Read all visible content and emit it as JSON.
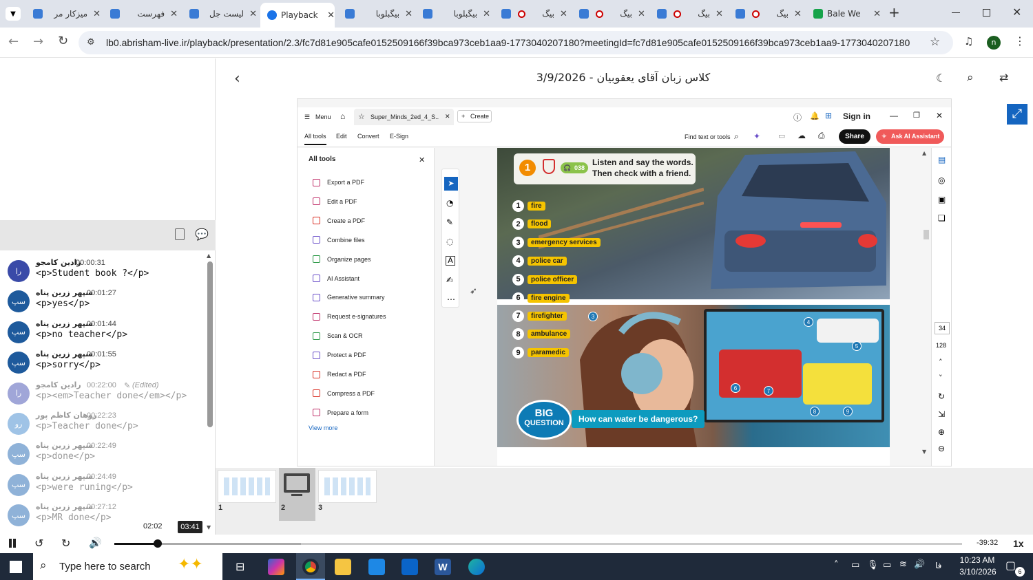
{
  "browser": {
    "tabs": [
      {
        "label": "میزکار مر",
        "type": "plain"
      },
      {
        "label": "فهرست",
        "type": "plain"
      },
      {
        "label": "لیست جل",
        "type": "plain"
      },
      {
        "label": "Playback",
        "type": "active"
      },
      {
        "label": "بیگبلوبا",
        "type": "plain"
      },
      {
        "label": "بیگبلوبا",
        "type": "plain"
      },
      {
        "label": "بیگ",
        "type": "rec"
      },
      {
        "label": "بیگ",
        "type": "rec"
      },
      {
        "label": "بیگ",
        "type": "rec"
      },
      {
        "label": "بیگ",
        "type": "rec"
      },
      {
        "label": "Bale We",
        "type": "bale"
      }
    ],
    "new_tab": "+",
    "url": "lb0.abrisham-live.ir/playback/presentation/2.3/fc7d81e905cafe0152509166f39bca973ceb1aa9-1773040207180?meetingId=fc7d81e905cafe0152509166f39bca973ceb1aa9-1773040207180",
    "profile_initial": "n"
  },
  "header": {
    "title": "کلاس زبان آقای یعقوبیان - 3/9/2026"
  },
  "chat": {
    "messages": [
      {
        "initials": "را",
        "name": "رادین کامجو",
        "time": "00:00:31",
        "text": "<p>Student book ?</p>",
        "edited": "",
        "faded": false,
        "color": "#3a4aa8"
      },
      {
        "initials": "سپ",
        "name": "سپهر زرین پناه",
        "time": "00:01:27",
        "text": "<p>yes</p>",
        "edited": "",
        "faded": false,
        "color": "#1e5a9c"
      },
      {
        "initials": "سپ",
        "name": "سپهر زرین پناه",
        "time": "00:01:44",
        "text": "<p>no teacher</p>",
        "edited": "",
        "faded": false,
        "color": "#1e5a9c"
      },
      {
        "initials": "سپ",
        "name": "سپهر زرین پناه",
        "time": "00:01:55",
        "text": "<p>sorry</p>",
        "edited": "",
        "faded": false,
        "color": "#1e5a9c"
      },
      {
        "initials": "را",
        "name": "رادین کامجو",
        "time": "00:22:00",
        "text": "<p><em>Teacher done</em></p>",
        "edited": "(Edited)",
        "faded": true,
        "color": "#a0a6d8"
      },
      {
        "initials": "رو",
        "name": "روهان کاظم پور",
        "time": "00:22:23",
        "text": "<p>Teacher done</p>",
        "edited": "",
        "faded": true,
        "color": "#9fc3e6"
      },
      {
        "initials": "سپ",
        "name": "سپهر زرین پناه",
        "time": "00:22:49",
        "text": "<p>done</p>",
        "edited": "",
        "faded": true,
        "color": "#8fb2d8"
      },
      {
        "initials": "سپ",
        "name": "سپهر زرین پناه",
        "time": "00:24:49",
        "text": "<p>were runing</p>",
        "edited": "",
        "faded": true,
        "color": "#8fb2d8"
      },
      {
        "initials": "سپ",
        "name": "سپهر زرین پناه",
        "time": "00:27:12",
        "text": "<p>MR done</p>",
        "edited": "",
        "faded": true,
        "color": "#8fb2d8"
      }
    ]
  },
  "acrobat": {
    "menu": "Menu",
    "doc_tab": "Super_Minds_2ed_4_S..",
    "create": "Create",
    "sign_in": "Sign in",
    "nav": [
      "All tools",
      "Edit",
      "Convert",
      "E-Sign"
    ],
    "find": "Find text or tools",
    "share": "Share",
    "ask_ai": "Ask AI Assistant",
    "panel_title": "All tools",
    "tools": [
      "Export a PDF",
      "Edit a PDF",
      "Create a PDF",
      "Combine files",
      "Organize pages",
      "AI Assistant",
      "Generative summary",
      "Request e-signatures",
      "Scan & OCR",
      "Protect a PDF",
      "Redact a PDF",
      "Compress a PDF",
      "Prepare a form"
    ],
    "view_more": "View more",
    "page_current": "34",
    "page_total": "128"
  },
  "book": {
    "exercise_num": "1",
    "audio_track": "038",
    "instruction_1": "Listen and say the words.",
    "instruction_2": "Then check with a friend.",
    "words": [
      {
        "n": "1",
        "w": "fire"
      },
      {
        "n": "2",
        "w": "flood"
      },
      {
        "n": "3",
        "w": "emergency services"
      },
      {
        "n": "4",
        "w": "police car"
      },
      {
        "n": "5",
        "w": "police officer"
      },
      {
        "n": "6",
        "w": "fire engine"
      },
      {
        "n": "7",
        "w": "firefighter"
      },
      {
        "n": "8",
        "w": "ambulance"
      },
      {
        "n": "9",
        "w": "paramedic"
      }
    ],
    "big_1": "BIG",
    "big_2": "QUESTION",
    "question": "How can water be dangerous?",
    "callouts": [
      "3",
      "4",
      "5",
      "6",
      "7",
      "8",
      "9"
    ]
  },
  "thumbnails": [
    "1",
    "2",
    "3"
  ],
  "player": {
    "hover_time": "02:02",
    "current_time": "03:41",
    "remaining": "-39:32",
    "speed": "1x",
    "progress": 0.051,
    "buffered": 0.22
  },
  "taskbar": {
    "search_placeholder": "Type here to search",
    "lang": "فا",
    "time": "10:23 AM",
    "date": "3/10/2026",
    "notifications": "6"
  }
}
